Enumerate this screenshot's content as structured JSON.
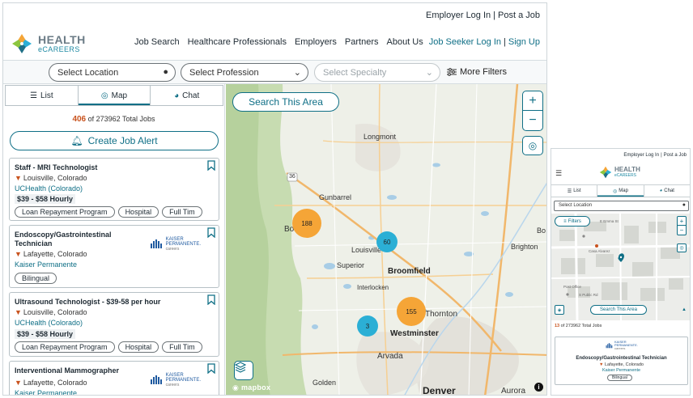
{
  "desktop": {
    "top_links": {
      "employer_login": "Employer Log In",
      "post_job": "Post a Job",
      "sep": "|"
    },
    "logo": {
      "line1": "HEALTH",
      "line2": "eCAREERS"
    },
    "nav": [
      "Job Search",
      "Healthcare Professionals",
      "Employers",
      "Partners",
      "About Us"
    ],
    "job_seeker": {
      "login": "Job Seeker Log In",
      "signup": "Sign Up",
      "sep": "|"
    },
    "filters": {
      "location_placeholder": "Select Location",
      "profession_placeholder": "Select Profession",
      "specialty_placeholder": "Select Specialty",
      "more_filters": "More Filters"
    },
    "view_tabs": {
      "list": "List",
      "map": "Map",
      "chat": "Chat",
      "active": "map"
    },
    "totals": {
      "count": "406",
      "suffix": "of 273962 Total Jobs"
    },
    "create_alert": "Create Job Alert",
    "jobs": [
      {
        "title": "Staff - MRI Technologist",
        "location": "Louisville, Colorado",
        "employer": "UCHealth (Colorado)",
        "salary": "$39 - $58 Hourly",
        "tags": [
          "Loan Repayment Program",
          "Hospital",
          "Full Tim"
        ]
      },
      {
        "title": "Endoscopy/Gastrointestinal Technician",
        "location": "Lafayette, Colorado",
        "employer": "Kaiser Permanente",
        "logo": {
          "line1": "KAISER",
          "line2": "PERMANENTE.",
          "line3": "careers"
        },
        "tags": [
          "Bilingual"
        ]
      },
      {
        "title": "Ultrasound Technologist - $39-58 per hour",
        "location": "Louisville, Colorado",
        "employer": "UCHealth (Colorado)",
        "salary": "$39 - $58 Hourly",
        "tags": [
          "Loan Repayment Program",
          "Hospital",
          "Full Tim"
        ]
      },
      {
        "title": "Interventional Mammographer",
        "location": "Lafayette, Colorado",
        "employer": "Kaiser Permanente",
        "logo": {
          "line1": "KAISER",
          "line2": "PERMANENTE.",
          "line3": "careers"
        }
      }
    ],
    "map": {
      "search_area": "Search This Area",
      "zoom_in": "+",
      "zoom_out": "−",
      "attribution": "mapbox",
      "info": "i",
      "places": [
        "Longmont",
        "Gunbarrel",
        "Louisville",
        "Superior",
        "Broomfield",
        "Interlocken",
        "Westminster",
        "Arvada",
        "Golden",
        "Denver",
        "Aurora",
        "Brighton",
        "Thornton",
        "Bo",
        "Bo"
      ],
      "route_label": "36",
      "clusters": [
        {
          "count": "188",
          "color": "#f5a537"
        },
        {
          "count": "60",
          "color": "#2bafd5"
        },
        {
          "count": "155",
          "color": "#f5a537"
        },
        {
          "count": "3",
          "color": "#2bafd5"
        }
      ]
    }
  },
  "mobile": {
    "top_links": {
      "employer_login": "Employer Log In",
      "post_job": "Post a Job",
      "sep": "|"
    },
    "logo": {
      "line1": "HEALTH",
      "line2": "eCAREERS"
    },
    "tabs": {
      "list": "List",
      "map": "Map",
      "chat": "Chat"
    },
    "location_placeholder": "Select Location",
    "filters": "Filters",
    "search_area": "Search This Area",
    "map_places": [
      "E Emma St",
      "S Public Rd",
      "Post Office",
      "Casa Alvarez"
    ],
    "totals": {
      "count": "13",
      "suffix": "of 273962 Total Jobs"
    },
    "card": {
      "logo": {
        "line1": "KAISER",
        "line2": "PERMANENTE.",
        "line3": "careers"
      },
      "title": "Endoscopy/Gastrointestinal Technician",
      "location": "Lafayette, Colorado",
      "employer": "Kaiser Permanente",
      "tag": "Bilingual"
    }
  },
  "colors": {
    "brand_teal": "#0f6f86",
    "accent_orange": "#c9531e",
    "cluster_orange": "#f5a537",
    "cluster_blue": "#2bafd5"
  }
}
